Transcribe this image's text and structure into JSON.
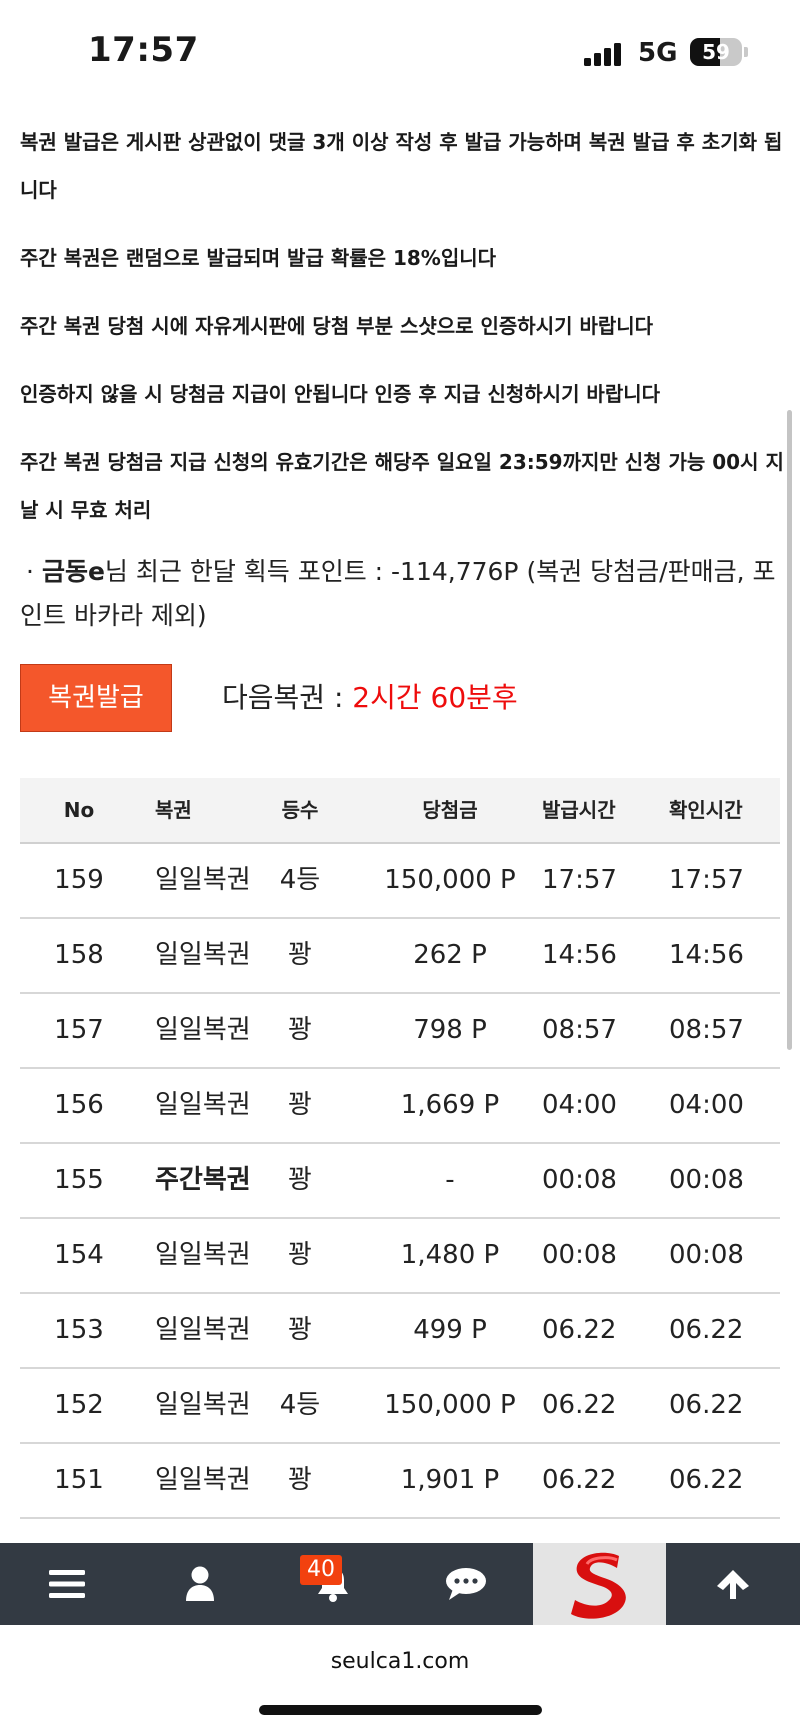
{
  "status_bar": {
    "time": "17:57",
    "network": "5G",
    "battery": "59"
  },
  "notices": [
    "복권 발급은 게시판 상관없이 댓글 3개 이상 작성 후 발급 가능하며 복권 발급 후 초기화 됩니다",
    "주간 복권은 랜덤으로 발급되며 발급 확률은 18%입니다",
    "주간 복권 당첨 시에 자유게시판에 당첨 부분 스샷으로 인증하시기 바랍니다",
    "인증하지 않을 시 당첨금 지급이 안됩니다 인증 후 지급 신청하시기 바랍니다",
    "주간 복권 당첨금 지급 신청의 유효기간은 해당주 일요일 23:59까지만 신청 가능 00시 지날 시 무효 처리"
  ],
  "points": {
    "bullet": "·",
    "user": "금동e",
    "text": "님 최근 한달 획득 포인트 : -114,776P (복권 당첨금/판매금, 포인트 바카라 제외)"
  },
  "issue_button": "복권발급",
  "next_lottery": {
    "label": "다음복권 : ",
    "value": "2시간 60분후"
  },
  "table": {
    "headers": [
      "No",
      "복권",
      "등수",
      "당첨금",
      "발급시간",
      "확인시간"
    ],
    "rows": [
      {
        "no": "159",
        "type": "일일복권",
        "rank": "4등",
        "prize": "150,000 P",
        "issued": "17:57",
        "checked": "17:57"
      },
      {
        "no": "158",
        "type": "일일복권",
        "rank": "꽝",
        "prize": "262 P",
        "issued": "14:56",
        "checked": "14:56"
      },
      {
        "no": "157",
        "type": "일일복권",
        "rank": "꽝",
        "prize": "798 P",
        "issued": "08:57",
        "checked": "08:57"
      },
      {
        "no": "156",
        "type": "일일복권",
        "rank": "꽝",
        "prize": "1,669 P",
        "issued": "04:00",
        "checked": "04:00"
      },
      {
        "no": "155",
        "type": "주간복권",
        "rank": "꽝",
        "prize": "-",
        "issued": "00:08",
        "checked": "00:08"
      },
      {
        "no": "154",
        "type": "일일복권",
        "rank": "꽝",
        "prize": "1,480 P",
        "issued": "00:08",
        "checked": "00:08"
      },
      {
        "no": "153",
        "type": "일일복권",
        "rank": "꽝",
        "prize": "499 P",
        "issued": "06.22",
        "checked": "06.22"
      },
      {
        "no": "152",
        "type": "일일복권",
        "rank": "4등",
        "prize": "150,000 P",
        "issued": "06.22",
        "checked": "06.22"
      },
      {
        "no": "151",
        "type": "일일복권",
        "rank": "꽝",
        "prize": "1,901 P",
        "issued": "06.22",
        "checked": "06.22"
      }
    ]
  },
  "bottom_nav": {
    "icons": [
      "menu-icon",
      "user-icon",
      "bell-icon",
      "chat-icon",
      "logo",
      "arrow-up-icon"
    ],
    "notification_count": "40"
  },
  "browser": {
    "url": "seulca1.com"
  },
  "colors": {
    "accent": "#f4572b",
    "highlight": "#ee0c0c",
    "nav_bg": "#333a43",
    "logo_red": "#d80f0f"
  }
}
